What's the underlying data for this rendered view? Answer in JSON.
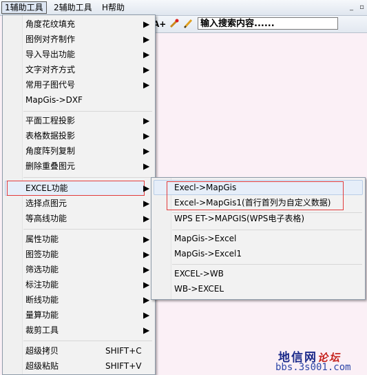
{
  "menubar": {
    "items": [
      {
        "label": "1辅助工具"
      },
      {
        "label": "2辅助工具"
      },
      {
        "label": "H帮助"
      }
    ],
    "window_controls": [
      "_",
      "▫"
    ]
  },
  "toolbar": {
    "font_larger_label": "A+",
    "pen_icon": "pen-icon",
    "pencil_icon": "pencil-icon",
    "search_value": "输入搜索内容......"
  },
  "main_menu": {
    "items": [
      {
        "label": "角度花纹填充",
        "submenu": true
      },
      {
        "label": "图例对齐制作",
        "submenu": true
      },
      {
        "label": "导入导出功能",
        "submenu": true
      },
      {
        "label": "文字对齐方式",
        "submenu": true
      },
      {
        "label": "常用子图代号",
        "submenu": true
      },
      {
        "label": "MapGis->DXF",
        "submenu": false
      },
      {
        "label": "平面工程投影",
        "submenu": true
      },
      {
        "label": "表格数据投影",
        "submenu": true
      },
      {
        "label": "角度阵列复制",
        "submenu": true
      },
      {
        "label": "删除重叠图元",
        "submenu": true
      },
      {
        "label": "EXCEL功能",
        "submenu": true,
        "active": true
      },
      {
        "label": "选择点图元",
        "submenu": true
      },
      {
        "label": "等高线功能",
        "submenu": true
      },
      {
        "label": "属性功能",
        "submenu": true
      },
      {
        "label": "图签功能",
        "submenu": true
      },
      {
        "label": "筛选功能",
        "submenu": true
      },
      {
        "label": "标注功能",
        "submenu": true
      },
      {
        "label": "断线功能",
        "submenu": true
      },
      {
        "label": "量算功能",
        "submenu": true
      },
      {
        "label": "裁剪工具",
        "submenu": true
      },
      {
        "label": "超级拷贝",
        "shortcut": "SHIFT+C"
      },
      {
        "label": "超级粘贴",
        "shortcut": "SHIFT+V"
      }
    ]
  },
  "sub_menu": {
    "items": [
      {
        "label": "Execl->MapGis"
      },
      {
        "label": "Excel->MapGis1(首行首列为自定义数据)"
      },
      {
        "label": "WPS ET->MAPGIS(WPS电子表格)"
      },
      {
        "label": "MapGis->Excel"
      },
      {
        "label": "MapGis->Excel1"
      },
      {
        "label": "EXCEL->WB"
      },
      {
        "label": "WB->EXCEL"
      }
    ]
  },
  "watermark": {
    "name_main": "地信网",
    "name_accent": "论坛",
    "url": "bbs.3s001.com"
  },
  "colors": {
    "highlight_red": "#e23b3b",
    "hover_blue": "#e6eef9",
    "watermark_blue": "#1b2a8a",
    "watermark_red": "#c5201b"
  }
}
